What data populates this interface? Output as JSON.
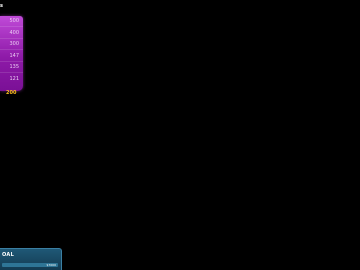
{
  "panel": {
    "title": "s"
  },
  "ladder": {
    "rows": [
      {
        "value": "500"
      },
      {
        "value": "400"
      },
      {
        "value": "300"
      },
      {
        "value": "147"
      },
      {
        "value": "135"
      },
      {
        "value": "121"
      }
    ],
    "current_value": "200"
  },
  "goal": {
    "label": "OAL",
    "bar_value": "$7000"
  },
  "colors": {
    "background": "#000000",
    "ladder_top": "#c04ad8",
    "ladder_bottom": "#7a1096",
    "ladder_text": "#eaccf2",
    "current_value": "#ffc21a",
    "goal_panel": "#1f5876",
    "goal_bar": "#2e7596"
  }
}
